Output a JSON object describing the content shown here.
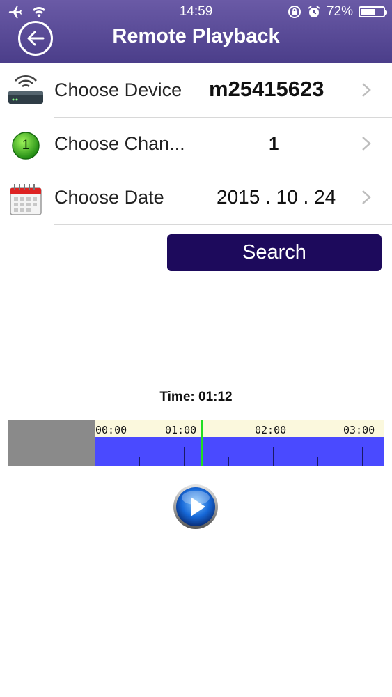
{
  "status_bar": {
    "time": "14:59",
    "battery_percent": "72%",
    "battery_level": 0.72
  },
  "header": {
    "title": "Remote Playback"
  },
  "rows": [
    {
      "label": "Choose Device",
      "value": "m25415623"
    },
    {
      "label": "Choose Chan...",
      "value": "1",
      "badge": "1"
    },
    {
      "label": "Choose Date",
      "value": "2015 . 10 . 24"
    }
  ],
  "search": {
    "label": "Search"
  },
  "timeline": {
    "time_label": "Time: 01:12",
    "ticks": [
      "00:00",
      "01:00",
      "02:00",
      "03:00"
    ]
  },
  "colors": {
    "header": "#5a4b97",
    "search": "#1d0a5c",
    "timeline_blue": "#4a4aff",
    "cursor": "#22dd22"
  },
  "icons": [
    "airplane-icon",
    "wifi-icon",
    "rotation-lock-icon",
    "alarm-icon",
    "battery-icon",
    "back-arrow-icon",
    "router-icon",
    "channel-badge-icon",
    "calendar-icon",
    "chevron-right-icon",
    "play-icon"
  ]
}
